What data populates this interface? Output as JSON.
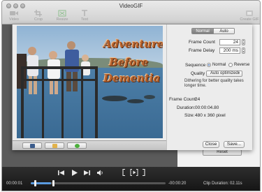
{
  "window": {
    "title": "VideoGIF"
  },
  "toolbar": {
    "items": [
      {
        "label": "Video",
        "icon": "video-icon"
      },
      {
        "label": "Crop",
        "icon": "crop-icon"
      },
      {
        "label": "Resize",
        "icon": "resize-icon"
      },
      {
        "label": "Text",
        "icon": "text-icon"
      },
      {
        "label": "Create GIF",
        "icon": "create-gif-icon"
      }
    ]
  },
  "preview": {
    "overlay_lines": [
      "Adventure",
      "Before",
      "Dementia"
    ],
    "overlay_color": "#b8632e"
  },
  "share": {
    "buttons": [
      {
        "name": "tumblr",
        "glyph": "t",
        "color": "#3b5c8c"
      },
      {
        "name": "email",
        "glyph": "✉",
        "color": "#e2b24a"
      },
      {
        "name": "messages",
        "glyph": "●",
        "color": "#4caf3c"
      }
    ]
  },
  "settings": {
    "tabs": {
      "active": "Normal",
      "inactive": "Auto"
    },
    "frame_count_label": "Frame Count",
    "frame_count_value": "24",
    "frame_delay_label": "Frame Delay",
    "frame_delay_value": "200 ms",
    "sequence_label": "Sequence",
    "sequence_options": [
      "Normal",
      "Reverse"
    ],
    "sequence_selected": "Normal",
    "quality_label": "Quality",
    "quality_value": "Auto optimized",
    "dithering_hint": "Dithering for better quality takes longer time.",
    "info": {
      "frame_count_label": "Frame Count:",
      "frame_count": "24",
      "duration_label": "Duration:",
      "duration": "00:00:04.80",
      "size_label": "Size:",
      "size": "480 x 360 pixel"
    },
    "close_label": "Close",
    "save_label": "Save..."
  },
  "behind": {
    "reset_label": "Reset"
  },
  "player": {
    "current_time": "00:00:01",
    "remaining_time": "-00:00:20",
    "clip_duration": "Clip Duration: 02.11s",
    "progress": 0.15,
    "accent": "#5a9be0"
  }
}
